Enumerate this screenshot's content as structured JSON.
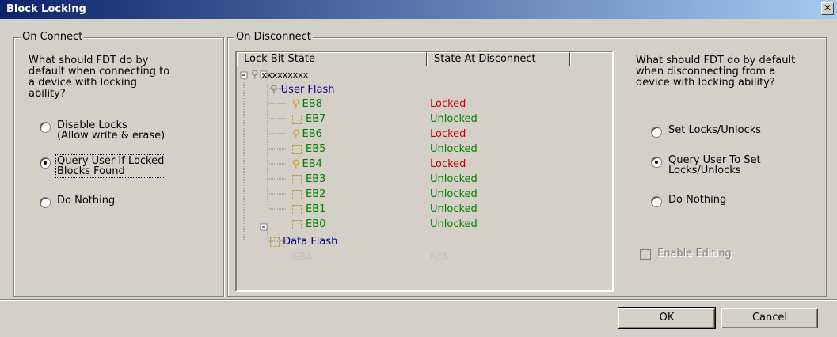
{
  "window": {
    "title": "Block Locking",
    "close_label": "✕"
  },
  "on_connect": {
    "label": "On Connect",
    "description": "What should FDT do by\ndefault when connecting to\na device with locking\nability?",
    "options": [
      {
        "label": "Disable Locks\n(Allow write & erase)",
        "selected": false
      },
      {
        "label": "Query User If Locked\nBlocks Found",
        "selected": true
      },
      {
        "label": "Do Nothing",
        "selected": false
      }
    ]
  },
  "on_disconnect": {
    "label": "On Disconnect",
    "description": "What should FDT do by default\nwhen disconnecting from a\ndevice with locking ability?",
    "options": [
      {
        "label": "Set Locks/Unlocks",
        "selected": false
      },
      {
        "label": "Query User To Set\nLocks/Unlocks",
        "selected": true
      },
      {
        "label": "Do Nothing",
        "selected": false
      }
    ],
    "enable_editing_label": "Enable Editing"
  },
  "tree": {
    "columns": [
      "Lock Bit State",
      "State At Disconnect",
      ""
    ],
    "root": "xxxxxxxxx",
    "user_flash": "User Flash",
    "data_flash": "Data Flash",
    "blocks": [
      {
        "name": "EB8",
        "state": "Locked",
        "locked": true
      },
      {
        "name": "EB7",
        "state": "Unlocked",
        "locked": false
      },
      {
        "name": "EB6",
        "state": "Locked",
        "locked": true
      },
      {
        "name": "EB5",
        "state": "Unlocked",
        "locked": false
      },
      {
        "name": "EB4",
        "state": "Locked",
        "locked": true
      },
      {
        "name": "EB3",
        "state": "Unlocked",
        "locked": false
      },
      {
        "name": "EB2",
        "state": "Unlocked",
        "locked": false
      },
      {
        "name": "EB1",
        "state": "Unlocked",
        "locked": false
      },
      {
        "name": "EB0",
        "state": "Unlocked",
        "locked": false
      }
    ],
    "data_block": {
      "name": "EBA",
      "state": "N/A"
    },
    "colors": {
      "locked": "#cc0000",
      "unlocked": "#008000",
      "node": "#000080",
      "disabled": "#c0c0c0"
    }
  },
  "buttons": {
    "ok": "OK",
    "cancel": "Cancel"
  }
}
